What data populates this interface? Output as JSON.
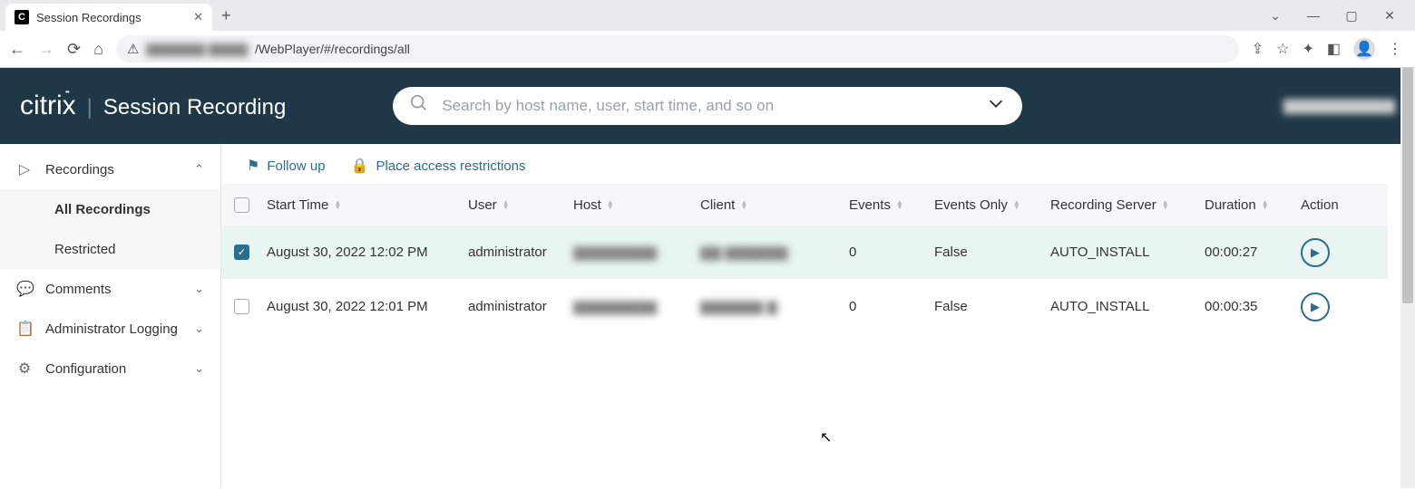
{
  "browser": {
    "tab_title": "Session Recordings",
    "url_obscured": "▇▇▇▇▇▇ ▇▇▇▇",
    "url_visible": "/WebPlayer/#/recordings/all"
  },
  "header": {
    "brand": "citrix",
    "product": "Session Recording",
    "user_obscured": "▇▇▇▇▇▇▇▇▇▇"
  },
  "search": {
    "placeholder": "Search by host name, user, start time, and so on"
  },
  "sidebar": {
    "recordings": "Recordings",
    "all_recordings": "All Recordings",
    "restricted": "Restricted",
    "comments": "Comments",
    "admin_logging": "Administrator Logging",
    "configuration": "Configuration"
  },
  "toolbar": {
    "follow_up": "Follow up",
    "restrict": "Place access restrictions"
  },
  "table": {
    "headers": {
      "start_time": "Start Time",
      "user": "User",
      "host": "Host",
      "client": "Client",
      "events": "Events",
      "events_only": "Events Only",
      "recording_server": "Recording Server",
      "duration": "Duration",
      "action": "Action"
    },
    "rows": [
      {
        "selected": true,
        "start_time": "August 30, 2022 12:02 PM",
        "user": "administrator",
        "host_obscured": "▇▇▇▇▇▇▇▇",
        "client_obscured": "▇▇ ▇▇▇▇▇▇",
        "events": "0",
        "events_only": "False",
        "recording_server": "AUTO_INSTALL",
        "duration": "00:00:27"
      },
      {
        "selected": false,
        "start_time": "August 30, 2022 12:01 PM",
        "user": "administrator",
        "host_obscured": "▇▇▇▇▇▇▇▇",
        "client_obscured": "▇▇▇▇▇▇ ▇",
        "events": "0",
        "events_only": "False",
        "recording_server": "AUTO_INSTALL",
        "duration": "00:00:35"
      }
    ]
  }
}
